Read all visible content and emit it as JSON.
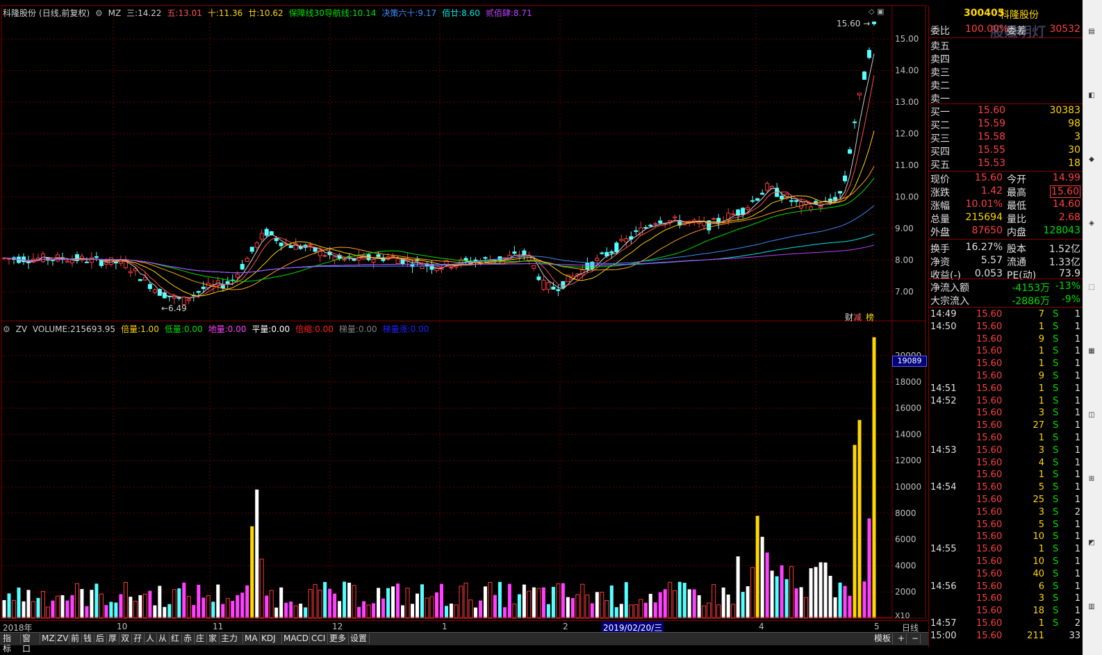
{
  "main_panel": {
    "stock_name": "科隆股份",
    "mode": "(日线,前复权)",
    "indicator": "MZ",
    "ma_lines": [
      {
        "label": "三:",
        "value": "14.22",
        "color": "#d0d0d0"
      },
      {
        "label": "五:",
        "value": "13.01",
        "color": "#ff5050"
      },
      {
        "label": "十:",
        "value": "11.36",
        "color": "#ffd700"
      },
      {
        "label": "廿:",
        "value": "10.62",
        "color": "#ffd700"
      },
      {
        "label": "保障线30导航线:",
        "value": "10.14",
        "color": "#00e000"
      },
      {
        "label": "决策六十:",
        "value": "9.17",
        "color": "#3a8cff"
      },
      {
        "label": "佰廿:",
        "value": "8.60",
        "color": "#00e5e5"
      },
      {
        "label": "贰佰肆:",
        "value": "8.71",
        "color": "#c040ff"
      }
    ],
    "high_marker": "15.60",
    "low_marker": "6.49",
    "price_axis": [
      "15.00",
      "14.00",
      "13.00",
      "12.00",
      "11.00",
      "10.00",
      "9.00",
      "8.00",
      "7.00"
    ],
    "badge_cai": "财",
    "badge_jian": "减",
    "badge_bang": "榜"
  },
  "volume_panel": {
    "indicator": "ZV",
    "items": [
      {
        "label": "VOLUME:",
        "value": "215693.95",
        "color": "#d0d0d0"
      },
      {
        "label": "倍量:",
        "value": "1.00",
        "color": "#ffd700"
      },
      {
        "label": "低量:",
        "value": "0.00",
        "color": "#00e000"
      },
      {
        "label": "地量:",
        "value": "0.00",
        "color": "#ff40ff"
      },
      {
        "label": "平量:",
        "value": "0.00",
        "color": "#ffffff"
      },
      {
        "label": "倍缩:",
        "value": "0.00",
        "color": "#ff2020"
      },
      {
        "label": "梯量:",
        "value": "0.00",
        "color": "#808080"
      },
      {
        "label": "梯量涨:",
        "value": "0.00",
        "color": "#2020ff"
      }
    ],
    "cursor_value": "19089",
    "unit": "X10",
    "axis": [
      "20000",
      "18000",
      "16000",
      "14000",
      "12000",
      "10000",
      "8000",
      "6000",
      "4000",
      "2000"
    ]
  },
  "chart_data": {
    "type": "candlestick",
    "title": "科隆股份 (日线,前复权)",
    "ylim": [
      6.4,
      15.8
    ],
    "x_labels": [
      "2018年",
      "10",
      "11",
      "12",
      "1",
      "2",
      "2019/02/20/三",
      "4",
      "5",
      "日线"
    ],
    "price_last": 15.6,
    "price_high": 15.6,
    "price_low": 6.49,
    "volume_ylim": [
      0,
      21000
    ],
    "volume_recent": [
      {
        "day": "-5",
        "volume": 13200,
        "color": "#ffd700"
      },
      {
        "day": "-4",
        "volume": 15100,
        "color": "#ffd700"
      },
      {
        "day": "-3",
        "volume": 2800,
        "color": "#ff40ff"
      },
      {
        "day": "-2",
        "volume": 7600,
        "color": "#ff40ff"
      },
      {
        "day": "-1",
        "volume": 21400,
        "color": "#ffd700"
      }
    ]
  },
  "quote": {
    "code": "300405",
    "name": "科隆股份",
    "weibi_label": "委比",
    "weibi": "100.00%",
    "weicha_label": "委差",
    "weicha": "30532",
    "sells": [
      {
        "label": "卖五",
        "price": "",
        "vol": ""
      },
      {
        "label": "卖四",
        "price": "",
        "vol": ""
      },
      {
        "label": "卖三",
        "price": "",
        "vol": ""
      },
      {
        "label": "卖二",
        "price": "",
        "vol": ""
      },
      {
        "label": "卖一",
        "price": "",
        "vol": ""
      }
    ],
    "buys": [
      {
        "label": "买一",
        "price": "15.60",
        "vol": "30383"
      },
      {
        "label": "买二",
        "price": "15.59",
        "vol": "98"
      },
      {
        "label": "买三",
        "price": "15.58",
        "vol": "3"
      },
      {
        "label": "买四",
        "price": "15.55",
        "vol": "30"
      },
      {
        "label": "买五",
        "price": "15.53",
        "vol": "18"
      }
    ],
    "stats": [
      {
        "l1": "现价",
        "v1": "15.60",
        "c1": "#ff4040",
        "l2": "今开",
        "v2": "14.99",
        "c2": "#ff4040"
      },
      {
        "l1": "涨跌",
        "v1": "1.42",
        "c1": "#ff4040",
        "l2": "最高",
        "v2": "15.60",
        "c2": "#ff4040"
      },
      {
        "l1": "涨幅",
        "v1": "10.01%",
        "c1": "#ff4040",
        "l2": "最低",
        "v2": "14.60",
        "c2": "#ff4040"
      },
      {
        "l1": "总量",
        "v1": "215694",
        "c1": "#ffd700",
        "l2": "量比",
        "v2": "2.68",
        "c2": "#ff4040"
      },
      {
        "l1": "外盘",
        "v1": "87650",
        "c1": "#ff4040",
        "l2": "内盘",
        "v2": "128043",
        "c2": "#00e000"
      },
      {
        "l1": "换手",
        "v1": "16.27%",
        "c1": "#e0e0e0",
        "l2": "股本",
        "v2": "1.52亿",
        "c2": "#e0e0e0"
      },
      {
        "l1": "净资",
        "v1": "5.57",
        "c1": "#e0e0e0",
        "l2": "流通",
        "v2": "1.33亿",
        "c2": "#e0e0e0"
      },
      {
        "l1": "收益(-)",
        "v1": "0.053",
        "c1": "#e0e0e0",
        "l2": "PE(动)",
        "v2": "73.9",
        "c2": "#e0e0e0"
      }
    ],
    "flows": [
      {
        "label": "净流入额",
        "value": "-4153万",
        "pct": "-13%"
      },
      {
        "label": "大宗流入",
        "value": "-2886万",
        "pct": "-9%"
      }
    ]
  },
  "ticks": [
    {
      "time": "14:49",
      "price": "15.60",
      "vol": "7",
      "side": "S",
      "n": "1"
    },
    {
      "time": "14:50",
      "price": "15.60",
      "vol": "1",
      "side": "S",
      "n": "1"
    },
    {
      "time": "",
      "price": "15.60",
      "vol": "9",
      "side": "S",
      "n": "1"
    },
    {
      "time": "",
      "price": "15.60",
      "vol": "1",
      "side": "S",
      "n": "1"
    },
    {
      "time": "",
      "price": "15.60",
      "vol": "1",
      "side": "S",
      "n": "1"
    },
    {
      "time": "",
      "price": "15.60",
      "vol": "9",
      "side": "S",
      "n": "1"
    },
    {
      "time": "14:51",
      "price": "15.60",
      "vol": "1",
      "side": "S",
      "n": "1"
    },
    {
      "time": "14:52",
      "price": "15.60",
      "vol": "1",
      "side": "S",
      "n": "1"
    },
    {
      "time": "",
      "price": "15.60",
      "vol": "3",
      "side": "S",
      "n": "1"
    },
    {
      "time": "",
      "price": "15.60",
      "vol": "27",
      "side": "S",
      "n": "1"
    },
    {
      "time": "",
      "price": "15.60",
      "vol": "1",
      "side": "S",
      "n": "1"
    },
    {
      "time": "14:53",
      "price": "15.60",
      "vol": "3",
      "side": "S",
      "n": "1"
    },
    {
      "time": "",
      "price": "15.60",
      "vol": "4",
      "side": "S",
      "n": "1"
    },
    {
      "time": "",
      "price": "15.60",
      "vol": "1",
      "side": "S",
      "n": "1"
    },
    {
      "time": "14:54",
      "price": "15.60",
      "vol": "5",
      "side": "S",
      "n": "1"
    },
    {
      "time": "",
      "price": "15.60",
      "vol": "25",
      "side": "S",
      "n": "1"
    },
    {
      "time": "",
      "price": "15.60",
      "vol": "3",
      "side": "S",
      "n": "2"
    },
    {
      "time": "",
      "price": "15.60",
      "vol": "5",
      "side": "S",
      "n": "1"
    },
    {
      "time": "",
      "price": "15.60",
      "vol": "10",
      "side": "S",
      "n": "1"
    },
    {
      "time": "14:55",
      "price": "15.60",
      "vol": "1",
      "side": "S",
      "n": "1"
    },
    {
      "time": "",
      "price": "15.60",
      "vol": "10",
      "side": "S",
      "n": "1"
    },
    {
      "time": "",
      "price": "15.60",
      "vol": "40",
      "side": "S",
      "n": "1"
    },
    {
      "time": "14:56",
      "price": "15.60",
      "vol": "6",
      "side": "S",
      "n": "1"
    },
    {
      "time": "",
      "price": "15.60",
      "vol": "3",
      "side": "S",
      "n": "1"
    },
    {
      "time": "",
      "price": "15.60",
      "vol": "18",
      "side": "S",
      "n": "1"
    },
    {
      "time": "14:57",
      "price": "15.60",
      "vol": "1",
      "side": "S",
      "n": "2"
    },
    {
      "time": "15:00",
      "price": "15.60",
      "vol": "211",
      "side": "",
      "n": "33"
    }
  ],
  "bottom_tabs": [
    "指标",
    "窗口",
    "MZ",
    "ZV",
    "前",
    "钱",
    "后",
    "厚",
    "双",
    "孖",
    "人",
    "从",
    "红",
    "赤",
    "庄",
    "家",
    "主力",
    "MA",
    "KDJ",
    "MACD",
    "CCI",
    "更多",
    "设置"
  ],
  "bottom_right_tabs": [
    "模板",
    "+",
    "−"
  ],
  "toolbar_icons": [
    "toolbar-btn-1",
    "toolbar-btn-2",
    "toolbar-btn-3",
    "toolbar-btn-4",
    "toolbar-btn-5",
    "toolbar-btn-6",
    "toolbar-btn-7",
    "toolbar-btn-8",
    "toolbar-btn-9",
    "toolbar-btn-10"
  ],
  "watermark": "股赚明灯"
}
